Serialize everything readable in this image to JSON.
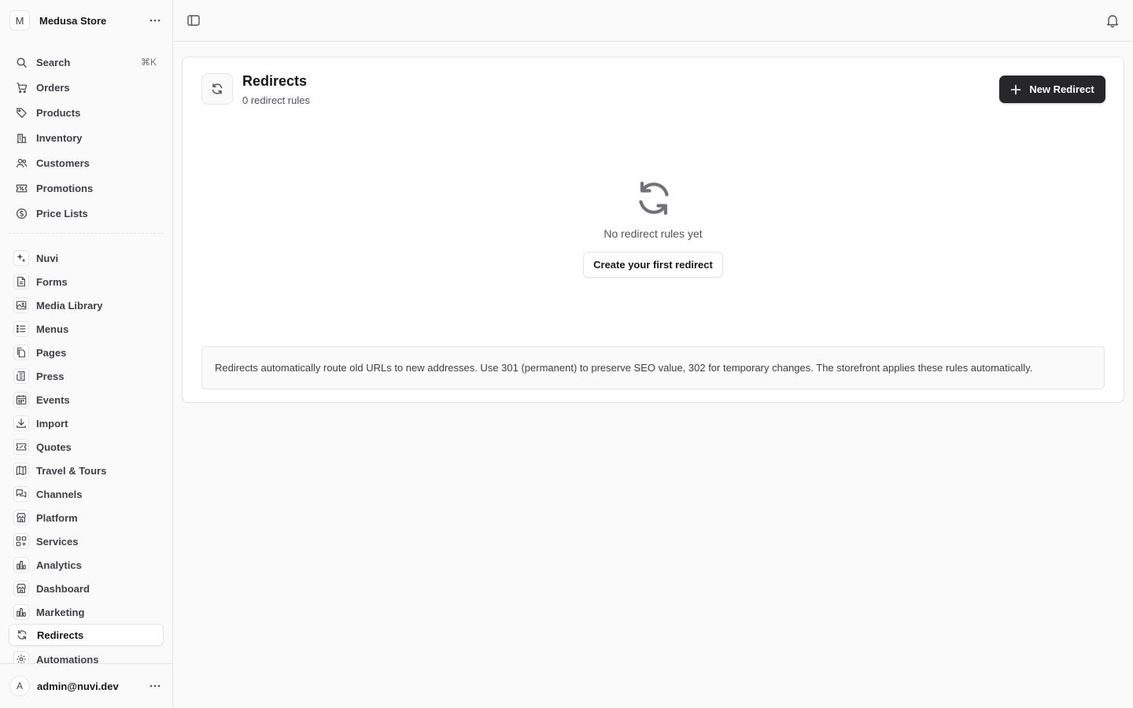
{
  "store": {
    "initial": "M",
    "name": "Medusa Store"
  },
  "search": {
    "label": "Search",
    "shortcut": "⌘K"
  },
  "nav_primary": [
    {
      "label": "Orders",
      "icon": "cart-icon"
    },
    {
      "label": "Products",
      "icon": "tag-icon"
    },
    {
      "label": "Inventory",
      "icon": "building-icon"
    },
    {
      "label": "Customers",
      "icon": "users-icon"
    },
    {
      "label": "Promotions",
      "icon": "receipt-percent-icon"
    },
    {
      "label": "Price Lists",
      "icon": "currency-icon"
    }
  ],
  "nav_extensions": [
    {
      "label": "Nuvi",
      "icon": "sparkles-icon"
    },
    {
      "label": "Forms",
      "icon": "document-icon"
    },
    {
      "label": "Media Library",
      "icon": "photo-icon"
    },
    {
      "label": "Menus",
      "icon": "list-icon"
    },
    {
      "label": "Pages",
      "icon": "documents-icon"
    },
    {
      "label": "Press",
      "icon": "newspaper-icon"
    },
    {
      "label": "Events",
      "icon": "calendar-icon"
    },
    {
      "label": "Import",
      "icon": "download-icon"
    },
    {
      "label": "Quotes",
      "icon": "receipt-percent-icon"
    },
    {
      "label": "Travel & Tours",
      "icon": "map-icon"
    },
    {
      "label": "Channels",
      "icon": "chat-bubbles-icon"
    },
    {
      "label": "Platform",
      "icon": "building-storefront-icon"
    },
    {
      "label": "Services",
      "icon": "squares-plus-icon"
    },
    {
      "label": "Analytics",
      "icon": "chart-bar-icon"
    },
    {
      "label": "Dashboard",
      "icon": "building-storefront-icon"
    },
    {
      "label": "Marketing",
      "icon": "chart-bar-icon"
    },
    {
      "label": "Redirects",
      "icon": "refresh-icon",
      "active": true
    },
    {
      "label": "Automations",
      "icon": "cog-icon"
    }
  ],
  "user": {
    "initial": "A",
    "email": "admin@nuvi.dev"
  },
  "page": {
    "title": "Redirects",
    "subtitle": "0 redirect rules",
    "new_button": "New Redirect",
    "empty_text": "No redirect rules yet",
    "create_button": "Create your first redirect",
    "info_note": "Redirects automatically route old URLs to new addresses. Use 301 (permanent) to preserve SEO value, 302 for temporary changes. The storefront applies these rules automatically."
  }
}
